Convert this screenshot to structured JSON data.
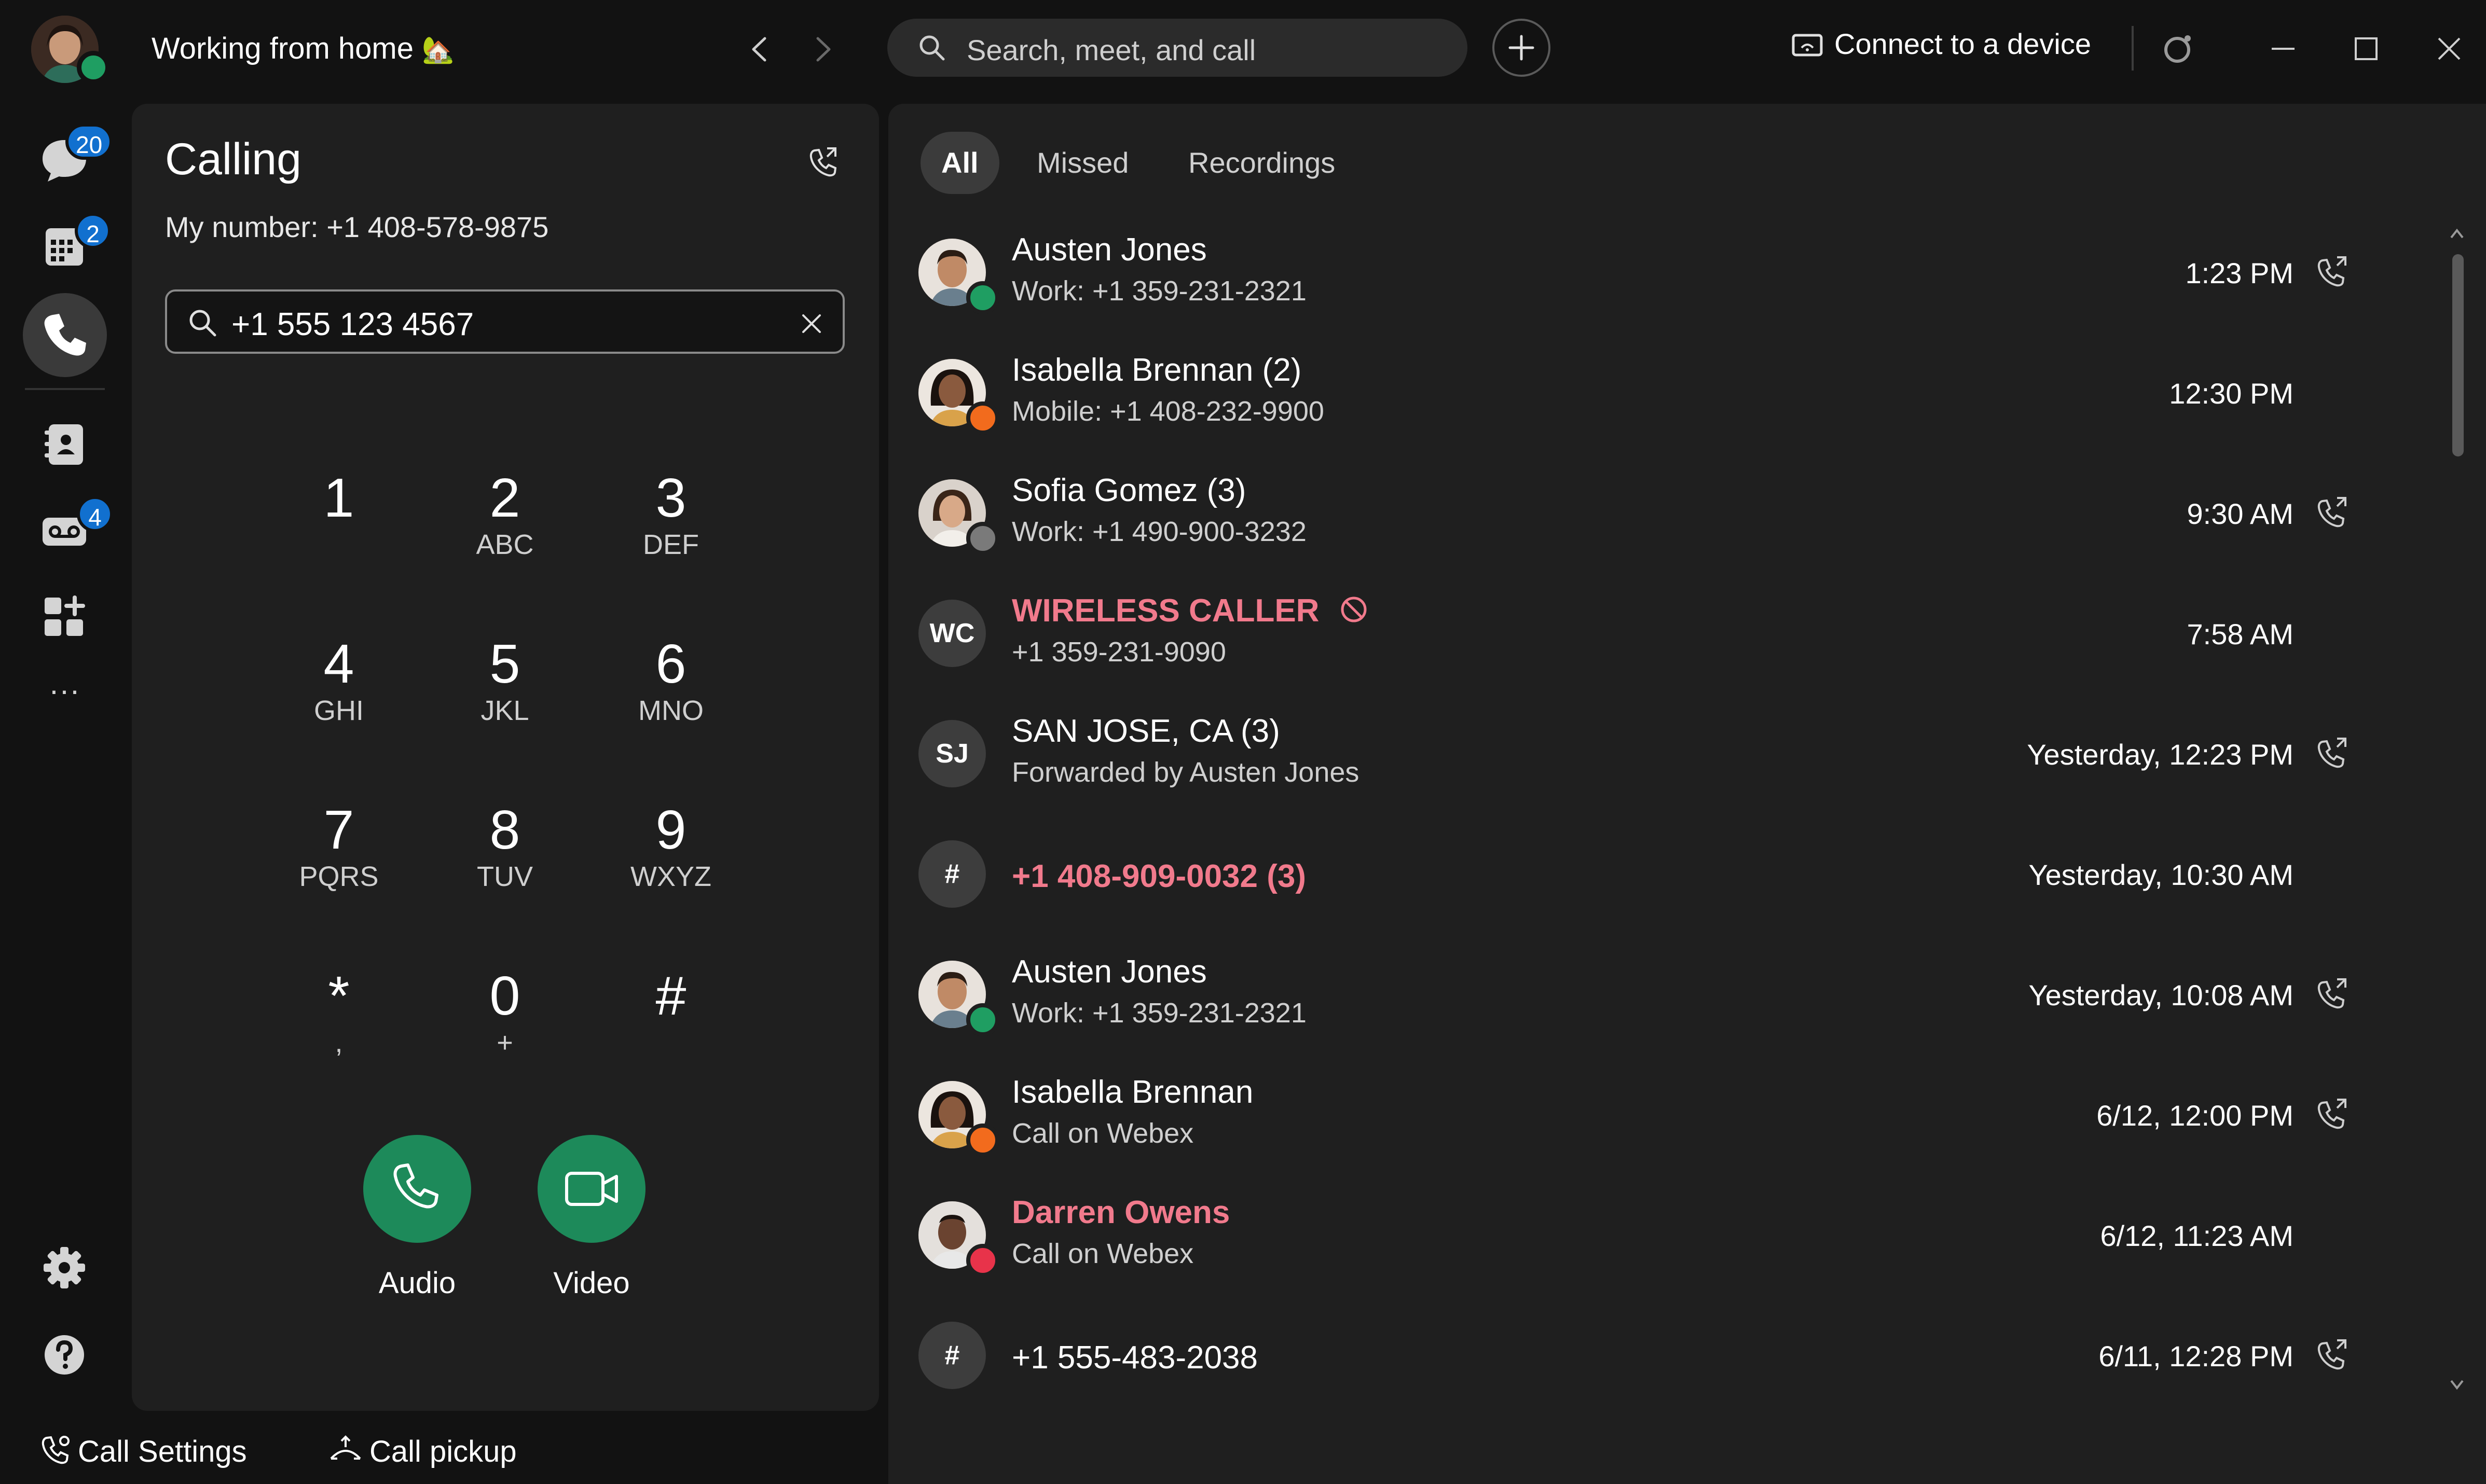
{
  "header": {
    "status_text": "Working from home",
    "status_emoji": "🏡",
    "search_placeholder": "Search, meet, and call",
    "connect_label": "Connect to a device"
  },
  "rail": {
    "messages_badge": "20",
    "calendar_badge": "2",
    "voicemail_badge": "4",
    "more_label": "···"
  },
  "calling": {
    "title": "Calling",
    "my_number": "My number: +1 408-578-9875",
    "dial_value": "+1 555 123 4567",
    "keys": [
      {
        "digit": "1",
        "letters": ""
      },
      {
        "digit": "2",
        "letters": "ABC"
      },
      {
        "digit": "3",
        "letters": "DEF"
      },
      {
        "digit": "4",
        "letters": "GHI"
      },
      {
        "digit": "5",
        "letters": "JKL"
      },
      {
        "digit": "6",
        "letters": "MNO"
      },
      {
        "digit": "7",
        "letters": "PQRS"
      },
      {
        "digit": "8",
        "letters": "TUV"
      },
      {
        "digit": "9",
        "letters": "WXYZ"
      },
      {
        "digit": "*",
        "letters": ","
      },
      {
        "digit": "0",
        "letters": "+"
      },
      {
        "digit": "#",
        "letters": ""
      }
    ],
    "audio_label": "Audio",
    "video_label": "Video"
  },
  "bottom": {
    "call_settings": "Call Settings",
    "call_pickup": "Call pickup"
  },
  "history": {
    "tabs": [
      "All",
      "Missed",
      "Recordings"
    ],
    "rows": [
      {
        "name": "Austen Jones",
        "sub": "Work: +1 359-231-2321",
        "time": "1:23 PM",
        "avatar": "photo",
        "initials": "",
        "status": "available",
        "missed": false,
        "callback": true
      },
      {
        "name": "Isabella Brennan (2)",
        "sub": "Mobile: +1 408-232-9900",
        "time": "12:30 PM",
        "avatar": "photo",
        "initials": "",
        "status": "on-call",
        "missed": false,
        "callback": false
      },
      {
        "name": "Sofia Gomez (3)",
        "sub": "Work: +1 490-900-3232",
        "time": "9:30 AM",
        "avatar": "photo",
        "initials": "",
        "status": "away",
        "missed": false,
        "callback": true
      },
      {
        "name": "WIRELESS CALLER",
        "sub": "+1 359-231-9090",
        "time": "7:58 AM",
        "avatar": "initials",
        "initials": "WC",
        "status": "",
        "missed": true,
        "blocked": true,
        "callback": false
      },
      {
        "name": "SAN JOSE, CA (3)",
        "sub": "Forwarded by Austen Jones",
        "time": "Yesterday, 12:23 PM",
        "avatar": "initials",
        "initials": "SJ",
        "status": "",
        "missed": false,
        "callback": true
      },
      {
        "name": "+1 408-909-0032 (3)",
        "sub": "",
        "time": "Yesterday, 10:30 AM",
        "avatar": "initials",
        "initials": "#",
        "status": "",
        "missed": true,
        "callback": false
      },
      {
        "name": "Austen Jones",
        "sub": "Work: +1 359-231-2321",
        "time": "Yesterday, 10:08 AM",
        "avatar": "photo",
        "initials": "",
        "status": "available",
        "missed": false,
        "callback": true
      },
      {
        "name": "Isabella Brennan",
        "sub": "Call on Webex",
        "time": "6/12, 12:00 PM",
        "avatar": "photo",
        "initials": "",
        "status": "on-call",
        "missed": false,
        "callback": true
      },
      {
        "name": "Darren Owens",
        "sub": "Call on Webex",
        "time": "6/12, 11:23 AM",
        "avatar": "photo",
        "initials": "",
        "status": "dnd",
        "missed": true,
        "callback": false
      },
      {
        "name": "+1 555-483-2038",
        "sub": "",
        "time": "6/11, 12:28 PM",
        "avatar": "initials",
        "initials": "#",
        "status": "",
        "missed": false,
        "callback": true
      }
    ]
  },
  "colors": {
    "background": "#121212",
    "panel": "#1f1f1f",
    "accent_green": "#1d8a5a",
    "badge_blue": "#1170cf",
    "missed_red": "#f17a8c",
    "presence_green": "#1f9e62",
    "presence_orange": "#f26b1d",
    "presence_gray": "#7a7a7a",
    "dnd_red": "#e8334a"
  },
  "icons": {
    "rail": [
      "messaging-icon",
      "calendar-icon",
      "phone-icon",
      "contacts-icon",
      "voicemail-icon",
      "apps-icon",
      "more-icon",
      "settings-icon",
      "help-icon"
    ],
    "row_callback": "phone-outgoing-icon"
  }
}
